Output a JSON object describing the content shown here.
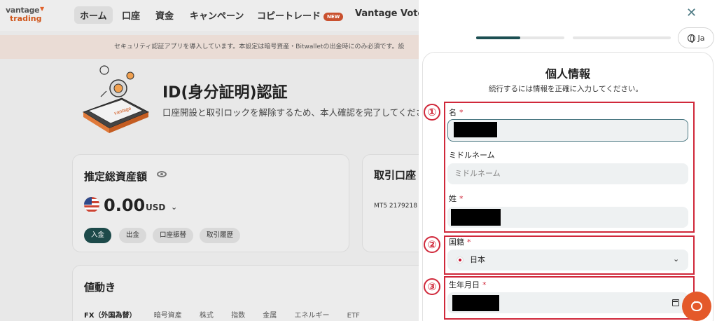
{
  "brand": {
    "line1": "vantage",
    "line2": "trading",
    "accent": "#e0602a"
  },
  "nav": {
    "items": [
      "ホーム",
      "口座",
      "資金",
      "キャンペーン",
      "コピートレード",
      "Vantage Vote"
    ],
    "new_badge": "NEW"
  },
  "notice": "セキュリティ認証アプリを導入しています。本設定は暗号資産・Bitwalletの出金時にのみ必須です。設",
  "id_section": {
    "title": "ID(身分証明)認証",
    "subtitle": "口座開設と取引ロックを解除するため、本人確認を完了してくださ"
  },
  "assets_card": {
    "title": "推定総資産額",
    "balance": "0.00",
    "currency": "USD",
    "buttons": [
      "入金",
      "出金",
      "口座振替",
      "取引履歴"
    ]
  },
  "account_card": {
    "title": "取引口座",
    "account_line": "MT5  2179218"
  },
  "market_card": {
    "title": "値動き",
    "tabs": [
      "FX（外国為替）",
      "暗号資産",
      "株式",
      "指数",
      "金属",
      "エネルギー",
      "ETF"
    ]
  },
  "modal": {
    "language": "Ja",
    "progress_steps": 2,
    "current_step": 1,
    "step1_progress": 0.5,
    "title": "個人情報",
    "subtitle": "続行するには情報を正確に入力してください。",
    "fields": {
      "first_name": {
        "label": "名",
        "required_mark": "*"
      },
      "middle_name": {
        "label": "ミドルネーム",
        "placeholder": "ミドルネーム"
      },
      "last_name": {
        "label": "姓",
        "required_mark": "*"
      },
      "nationality": {
        "label": "国籍",
        "required_mark": "*",
        "value": "日本"
      },
      "birthdate": {
        "label": "生年月日",
        "required_mark": "*"
      }
    },
    "annotations": [
      "①",
      "②",
      "③"
    ],
    "accent_color": "#1c4f52",
    "annotation_color": "#d0283a"
  },
  "chat_button_color": "#e4592a"
}
